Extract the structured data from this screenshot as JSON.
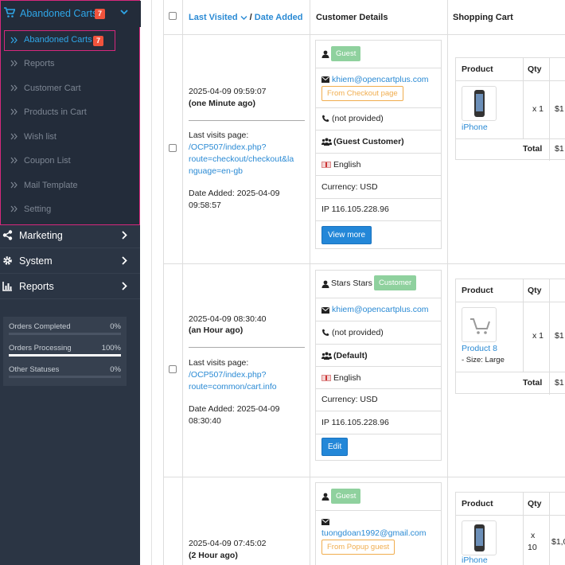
{
  "sidebar": {
    "header": {
      "title": "Abandoned Carts",
      "badge": "7"
    },
    "active_item": {
      "label": "Abandoned Carts",
      "badge": "7"
    },
    "sub_items": [
      {
        "label": "Reports"
      },
      {
        "label": "Customer Cart"
      },
      {
        "label": "Products in Cart"
      },
      {
        "label": "Wish list"
      },
      {
        "label": "Coupon List"
      },
      {
        "label": "Mail Template"
      },
      {
        "label": "Setting"
      }
    ],
    "main_items": [
      {
        "label": "Marketing",
        "icon": "share-icon"
      },
      {
        "label": "System",
        "icon": "gear-icon"
      },
      {
        "label": "Reports",
        "icon": "bar-chart-icon"
      }
    ],
    "stats": [
      {
        "label": "Orders Completed",
        "value": "0%",
        "fraction": 0.0
      },
      {
        "label": "Orders Processing",
        "value": "100%",
        "fraction": 1.0
      },
      {
        "label": "Other Statuses",
        "value": "0%",
        "fraction": 0.0
      }
    ]
  },
  "table": {
    "headers": {
      "last_visited": "Last Visited",
      "slash": "/",
      "date_added": "Date Added",
      "customer_details": "Customer Details",
      "shopping_cart": "Shopping Cart"
    },
    "rows": [
      {
        "visited": "2025-04-09 09:59:07",
        "visited_ago": "(one Minute ago)",
        "last_visits_label": "Last visits page:",
        "page_line1": "/OCP507/index.php?",
        "page_line2": "route=checkout/checkout&la",
        "page_line3": "nguage=en-gb",
        "date_added_line1": "Date Added: 2025-04-09",
        "date_added_line2": "09:58:57",
        "customer_name": "",
        "customer_label": "Guest",
        "email": "khiem@opencartplus.com",
        "source": "From Checkout page",
        "phone": "(not provided)",
        "group": "(Guest Customer)",
        "language": "English",
        "currency": "Currency: USD",
        "ip": "IP 116.105.228.96",
        "action": "View more",
        "cart": {
          "product_header": "Product",
          "qty_header": "Qty",
          "product": "iPhone",
          "option": "",
          "qty": "x 1",
          "price": "$1",
          "total_label": "Total",
          "total": "$1"
        }
      },
      {
        "visited": "2025-04-09 08:30:40",
        "visited_ago": "(an Hour ago)",
        "last_visits_label": "Last visits page:",
        "page_line1": "/OCP507/index.php?",
        "page_line2": "route=common/cart.info",
        "page_line3": "",
        "date_added_line1": "Date Added: 2025-04-09",
        "date_added_line2": "08:30:40",
        "customer_name": "Stars Stars",
        "customer_label": "Customer",
        "email": "khiem@opencartplus.com",
        "source": "",
        "phone": "(not provided)",
        "group": "(Default)",
        "language": "English",
        "currency": "Currency: USD",
        "ip": "IP 116.105.228.96",
        "action": "Edit",
        "cart": {
          "product_header": "Product",
          "qty_header": "Qty",
          "product": "Product 8",
          "option": "- Size: Large",
          "qty": "x 1",
          "price": "$1",
          "total_label": "Total",
          "total": "$1"
        }
      },
      {
        "visited": "2025-04-09 07:45:02",
        "visited_ago": "(2 Hour ago)",
        "customer_label": "Guest",
        "email": "tuongdoan1992@gmail.com",
        "source": "From Popup guest",
        "cart": {
          "product_header": "Product",
          "qty_header": "Qty",
          "product": "iPhone",
          "qty_line1": "x",
          "qty_line2": "10",
          "price": "$1,0"
        }
      }
    ]
  }
}
